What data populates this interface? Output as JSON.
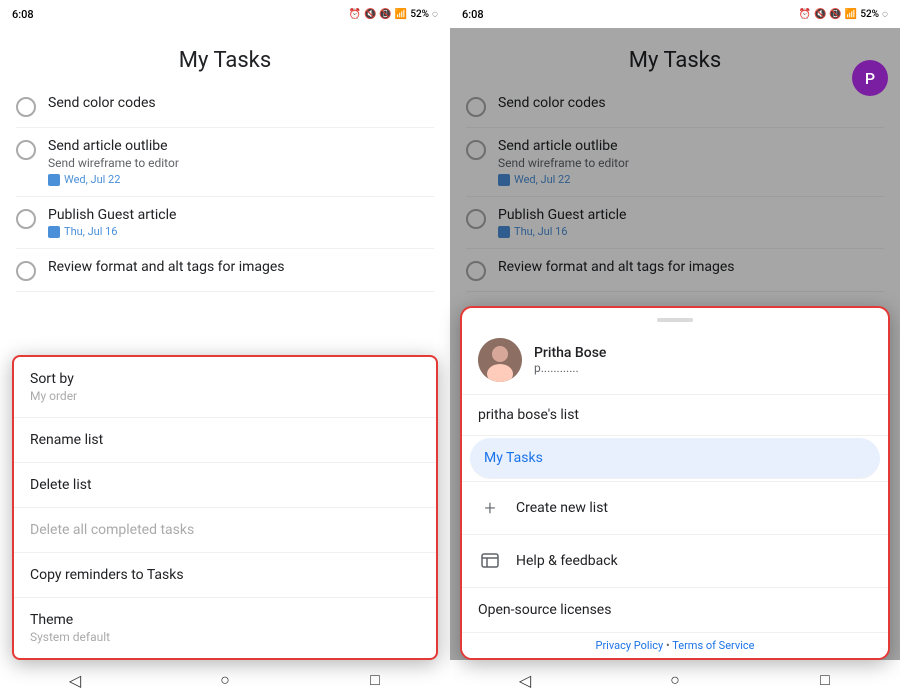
{
  "left_panel": {
    "status_time": "6:08",
    "status_icons": "⏰ 🔊 📶 52%",
    "app_title": "My Tasks",
    "tasks": [
      {
        "id": 1,
        "name": "Send color codes",
        "subtitle": "",
        "date": ""
      },
      {
        "id": 2,
        "name": "Send article outlibe",
        "subtitle": "Send wireframe to editor",
        "date": "Wed, Jul 22"
      },
      {
        "id": 3,
        "name": "Publish Guest article",
        "subtitle": "",
        "date": "Thu, Jul 16"
      },
      {
        "id": 4,
        "name": "Review format and alt tags for images",
        "subtitle": "",
        "date": ""
      }
    ],
    "bottom_sheet": {
      "items": [
        {
          "label": "Sort by",
          "sub": "My order",
          "disabled": false
        },
        {
          "label": "Rename list",
          "sub": "",
          "disabled": false
        },
        {
          "label": "Delete list",
          "sub": "",
          "disabled": false
        },
        {
          "label": "Delete all completed tasks",
          "sub": "",
          "disabled": true
        },
        {
          "label": "Copy reminders to Tasks",
          "sub": "",
          "disabled": false
        },
        {
          "label": "Theme",
          "sub": "System default",
          "disabled": false
        }
      ]
    },
    "nav": {
      "back": "◁",
      "home": "○",
      "recents": "□"
    }
  },
  "right_panel": {
    "status_time": "6:08",
    "status_icons": "⏰ 🔊 📶 52%",
    "app_title": "My Tasks",
    "tasks": [
      {
        "id": 1,
        "name": "Send color codes",
        "subtitle": "",
        "date": ""
      },
      {
        "id": 2,
        "name": "Send article outlibe",
        "subtitle": "Send wireframe to editor",
        "date": "Wed, Jul 22"
      },
      {
        "id": 3,
        "name": "Publish Guest article",
        "subtitle": "",
        "date": "Thu, Jul 16"
      },
      {
        "id": 4,
        "name": "Review format and alt tags for images",
        "subtitle": "",
        "date": ""
      }
    ],
    "avatar_letter": "P",
    "bottom_sheet": {
      "user_name": "Pritha Bose",
      "user_email": "p............",
      "list_items": [
        {
          "label": "pritha bose's list",
          "active": false
        },
        {
          "label": "My Tasks",
          "active": true
        }
      ],
      "actions": [
        {
          "label": "Create new list",
          "icon": "+"
        },
        {
          "label": "Help & feedback",
          "icon": "💬"
        },
        {
          "label": "Open-source licenses",
          "icon": ""
        }
      ]
    },
    "privacy_footer": "Privacy Policy  •  Terms of Service",
    "nav": {
      "back": "◁",
      "home": "○",
      "recents": "□"
    }
  }
}
